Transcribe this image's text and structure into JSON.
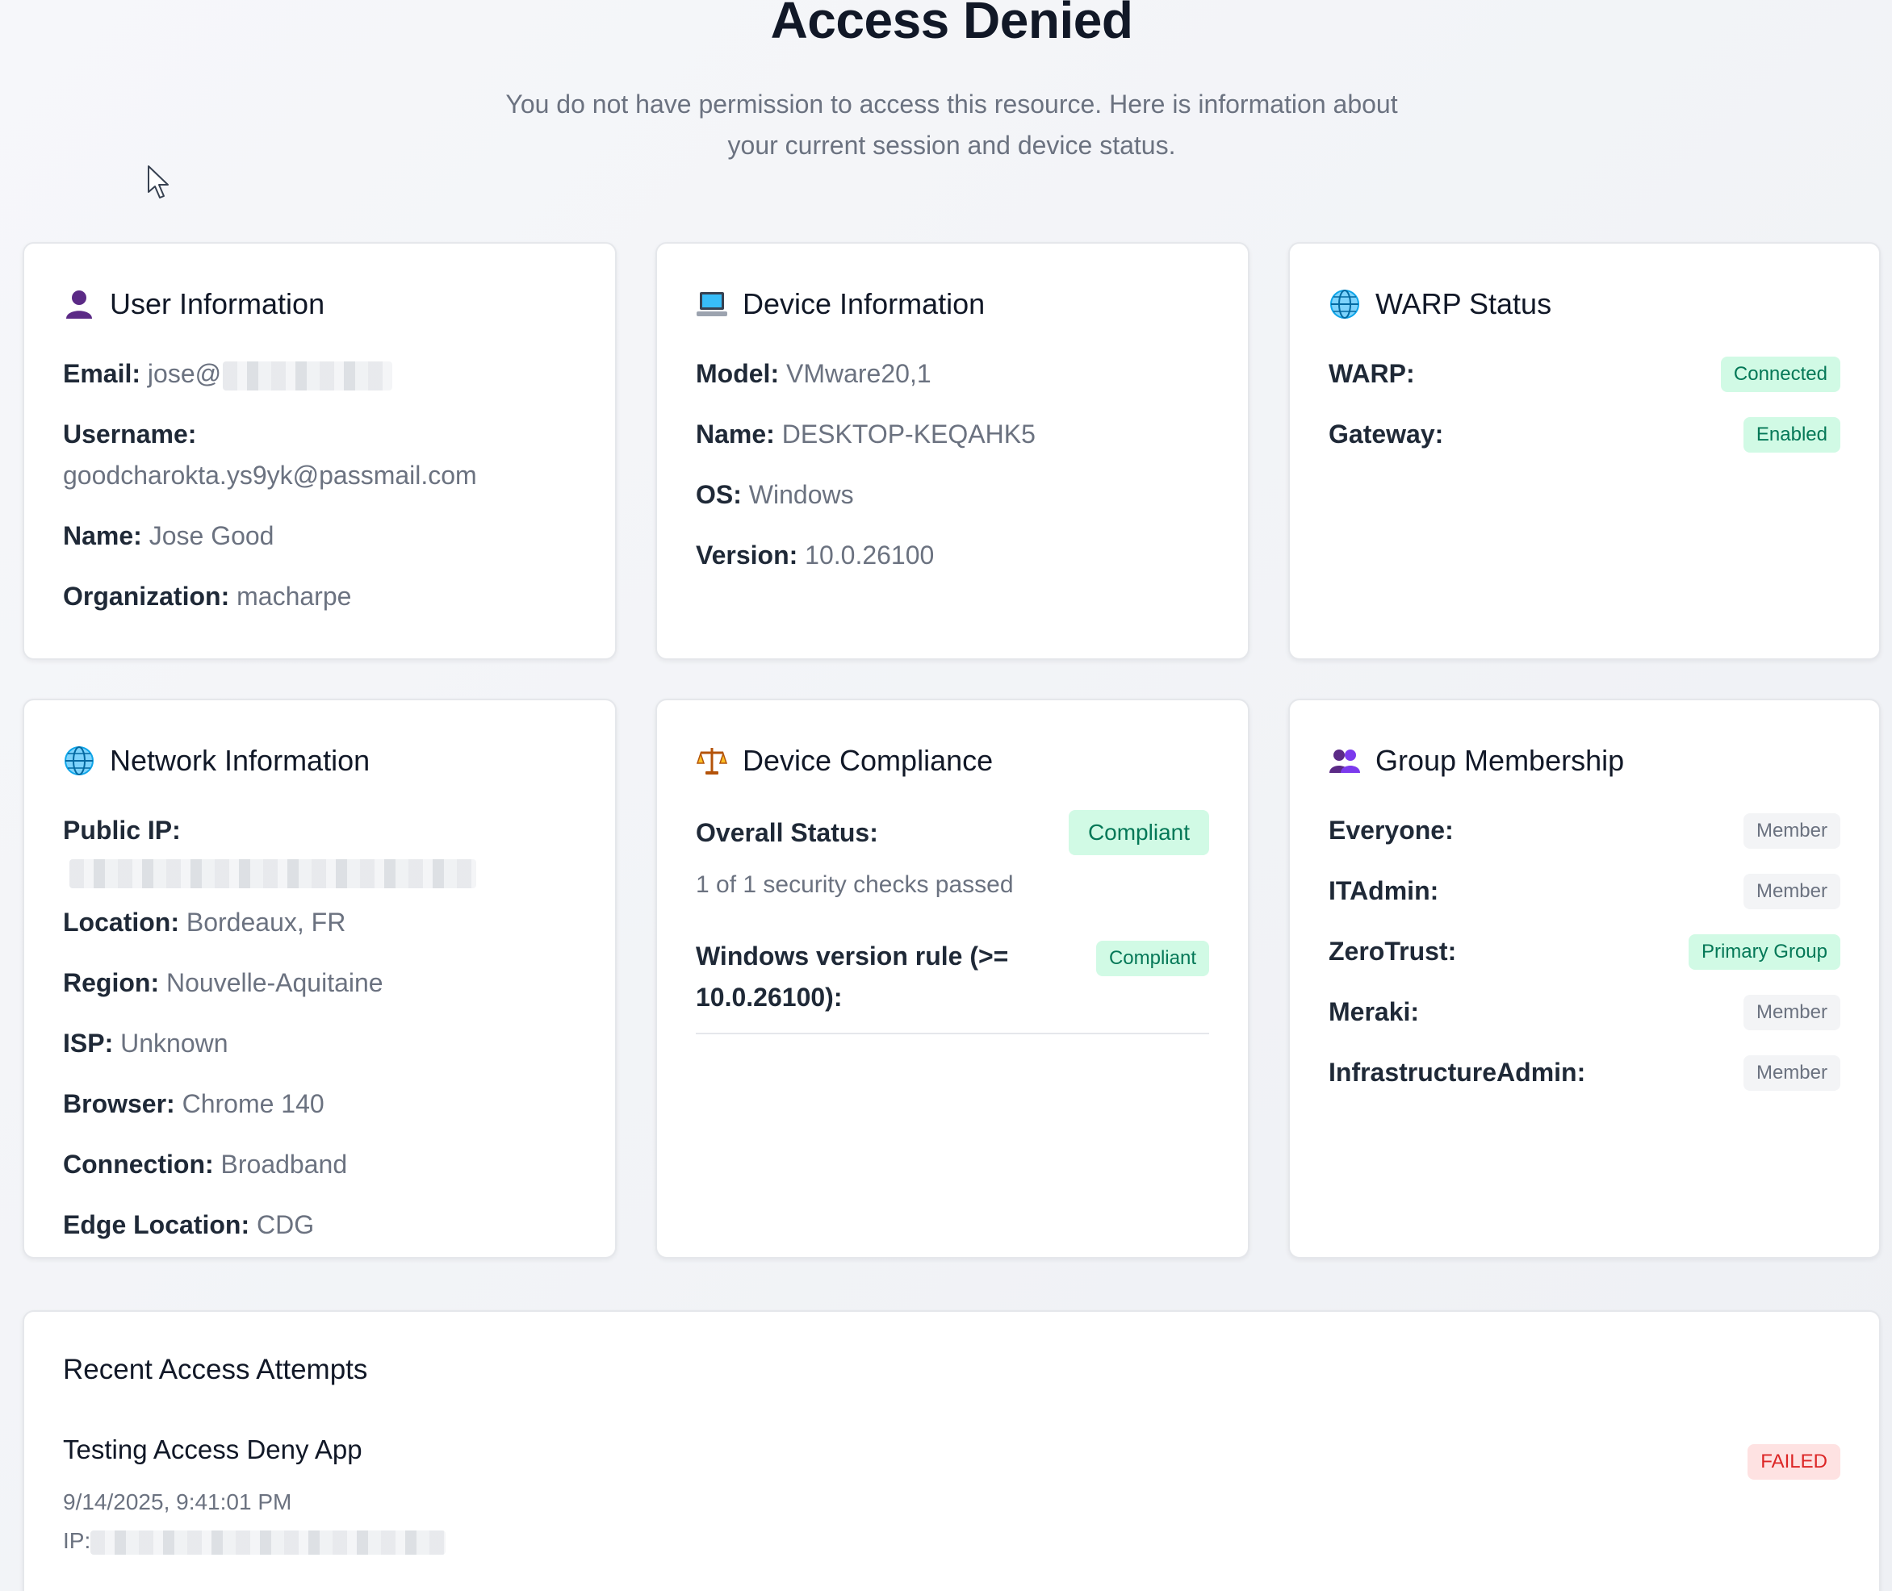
{
  "page": {
    "title": "Access Denied",
    "subtitle": "You do not have permission to access this resource. Here is information about your current session and device status."
  },
  "user_info": {
    "title": "User Information",
    "icon": "user-icon",
    "email_label": "Email:",
    "email_value": "jose@",
    "username_label": "Username:",
    "username_value": "goodcharokta.ys9yk@passmail.com",
    "name_label": "Name:",
    "name_value": "Jose Good",
    "org_label": "Organization:",
    "org_value": "macharpe"
  },
  "device_info": {
    "title": "Device Information",
    "icon": "laptop-icon",
    "model_label": "Model:",
    "model_value": "VMware20,1",
    "name_label": "Name:",
    "name_value": "DESKTOP-KEQAHK5",
    "os_label": "OS:",
    "os_value": "Windows",
    "version_label": "Version:",
    "version_value": "10.0.26100"
  },
  "warp_status": {
    "title": "WARP Status",
    "icon": "globe-icon",
    "warp_label": "WARP:",
    "warp_value": "Connected",
    "gateway_label": "Gateway:",
    "gateway_value": "Enabled"
  },
  "network_info": {
    "title": "Network Information",
    "icon": "globe-icon",
    "public_ip_label": "Public IP:",
    "location_label": "Location:",
    "location_value": "Bordeaux, FR",
    "region_label": "Region:",
    "region_value": "Nouvelle-Aquitaine",
    "isp_label": "ISP:",
    "isp_value": "Unknown",
    "browser_label": "Browser:",
    "browser_value": "Chrome 140",
    "connection_label": "Connection:",
    "connection_value": "Broadband",
    "edge_label": "Edge Location:",
    "edge_value": "CDG"
  },
  "device_compliance": {
    "title": "Device Compliance",
    "icon": "scales-icon",
    "overall_label": "Overall Status:",
    "overall_value": "Compliant",
    "checks_text": "1 of 1 security checks passed",
    "rule_label": "Windows version rule (>= 10.0.26100):",
    "rule_value": "Compliant"
  },
  "group_membership": {
    "title": "Group Membership",
    "icon": "users-icon",
    "groups": [
      {
        "name": "Everyone:",
        "role": "Member",
        "primary": false
      },
      {
        "name": "ITAdmin:",
        "role": "Member",
        "primary": false
      },
      {
        "name": "ZeroTrust:",
        "role": "Primary Group",
        "primary": true
      },
      {
        "name": "Meraki:",
        "role": "Member",
        "primary": false
      },
      {
        "name": "InfrastructureAdmin:",
        "role": "Member",
        "primary": false
      }
    ]
  },
  "recent_attempts": {
    "title": "Recent Access Attempts",
    "items": [
      {
        "app": "Testing Access Deny App",
        "timestamp": "9/14/2025, 9:41:01 PM",
        "ip_label": "IP:",
        "status": "FAILED"
      }
    ]
  },
  "colors": {
    "success_bg": "#d1fae5",
    "success_text": "#047857",
    "danger_bg": "#fee2e2",
    "danger_text": "#dc2626",
    "neutral_bg": "#f3f4f6"
  }
}
